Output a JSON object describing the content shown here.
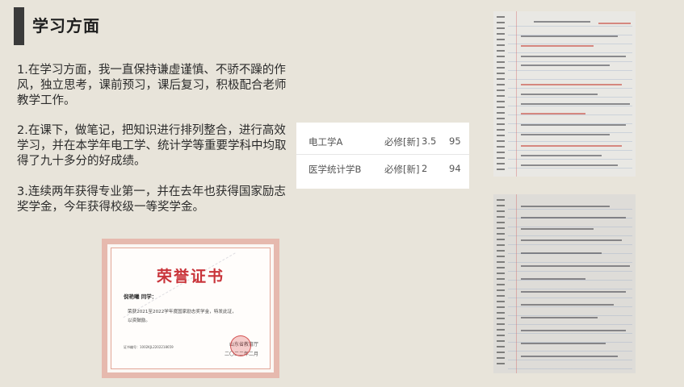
{
  "header": {
    "title": "学习方面"
  },
  "paragraphs": [
    "1.在学习方面，我一直保持谦虚谨慎、不骄不躁的作风，独立思考，课前预习，课后复习，积极配合老师教学工作。",
    "2.在课下，做笔记，把知识进行排列整合，进行高效学习，并在本学年电工学、统计学等重要学科中均取得了九十多分的好成绩。",
    "3.连续两年获得专业第一，并在去年也获得国家励志奖学金，今年获得校级一等奖学金。"
  ],
  "grades_table": {
    "rows": [
      {
        "course": "电工学A",
        "type": "必修[新]",
        "credit": "3.5",
        "score": "95"
      },
      {
        "course": "医学统计学B",
        "type": "必修[新]",
        "credit": "2",
        "score": "94"
      }
    ]
  },
  "certificate": {
    "title": "荣誉证书",
    "name_line": "倪艳曦 同学：",
    "body_line1": "荣获2021至2022学年度国家励志奖学金，特发此证，",
    "body_line2": "以资鼓励。",
    "number": "证书编号：1002KJL2202218659",
    "issuer": "山东省教育厅",
    "date": "二〇二二年二月"
  },
  "colors": {
    "background": "#e8e4da",
    "title_bar": "#3a3a3a",
    "certificate_red": "#c9343a"
  }
}
